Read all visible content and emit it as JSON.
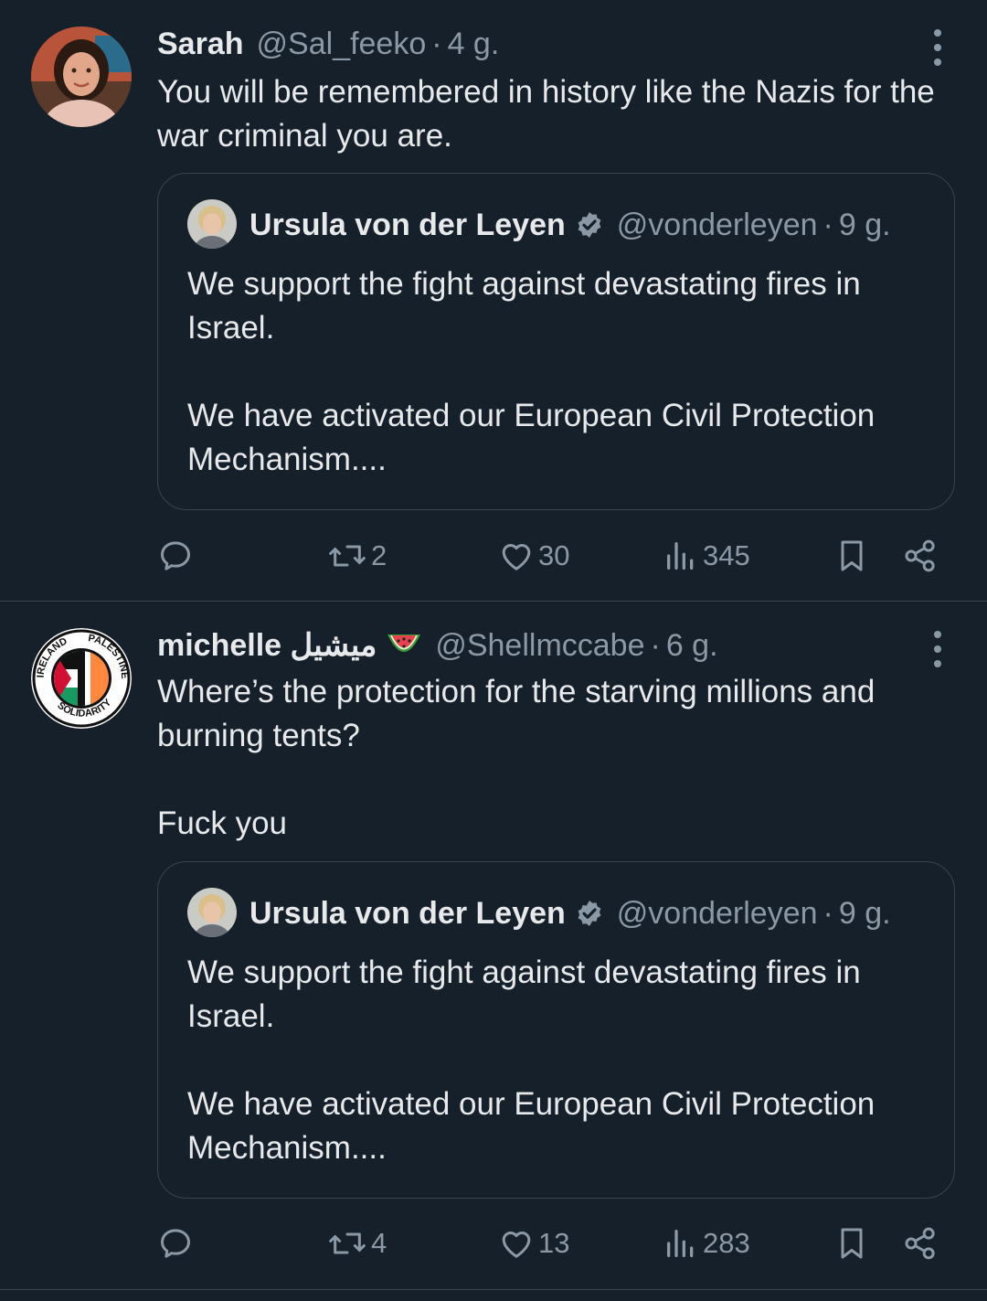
{
  "tweets": [
    {
      "display_name": "Sarah",
      "handle": "@Sal_feeko",
      "separator": "·",
      "time": "4 g.",
      "text": "You will be remembered in history like the Nazis for the\nwar criminal you are.",
      "avatar_icon": "profile-photo",
      "quoted": {
        "display_name": "Ursula von der Leyen",
        "verified": true,
        "handle": "@vonderleyen",
        "separator": "·",
        "time": "9 g.",
        "text": "We support the fight against devastating fires in\nIsrael.\n\nWe have activated our European Civil Protection\nMechanism...."
      },
      "actions": {
        "reply_count": "",
        "retweet_count": "2",
        "like_count": "30",
        "view_count": "345"
      }
    },
    {
      "display_name": "michelle ميشيل",
      "display_emoji": "🍉",
      "handle": "@Shellmccabe",
      "separator": "·",
      "time": "6 g.",
      "text": "Where’s the protection for the starving millions and\nburning tents?\n\nFuck you",
      "avatar_icon": "ireland-palestine-solidarity-logo",
      "avatar_logo_text": {
        "left": "IRELAND",
        "right": "PALESTINE",
        "bottom": "SOLIDARITY"
      },
      "quoted": {
        "display_name": "Ursula von der Leyen",
        "verified": true,
        "handle": "@vonderleyen",
        "separator": "·",
        "time": "9 g.",
        "text": "We support the fight against devastating fires in\nIsrael.\n\nWe have activated our European Civil Protection\nMechanism...."
      },
      "actions": {
        "reply_count": "",
        "retweet_count": "4",
        "like_count": "13",
        "view_count": "283"
      }
    }
  ],
  "colors": {
    "background": "#15202b",
    "text": "#e7e9ea",
    "secondary": "#8b98a5",
    "border": "#38444d"
  }
}
